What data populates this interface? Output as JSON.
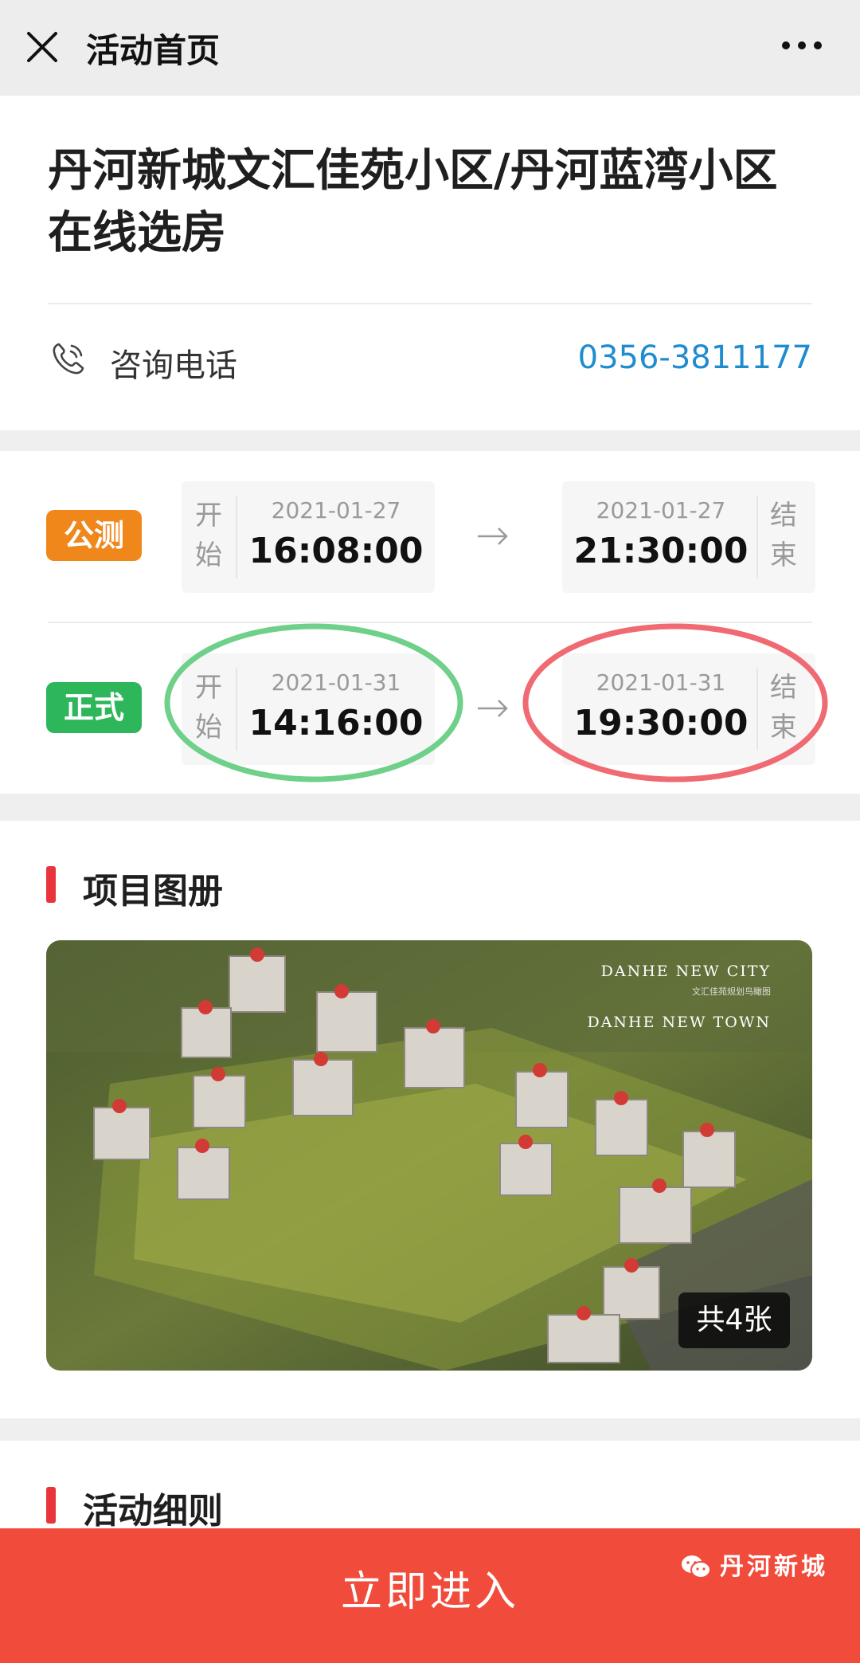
{
  "topbar": {
    "title": "活动首页"
  },
  "event": {
    "title": "丹河新城文汇佳苑小区/丹河蓝湾小区在线选房",
    "phone_label": "咨询电话",
    "phone_number": "0356-3811177"
  },
  "schedule": {
    "start_label_1": "开",
    "start_label_2": "始",
    "end_label_1": "结",
    "end_label_2": "束",
    "rows": [
      {
        "badge": "公测",
        "badge_color": "#f0871a",
        "start_date": "2021-01-27",
        "start_time": "16:08:00",
        "end_date": "2021-01-27",
        "end_time": "21:30:00"
      },
      {
        "badge": "正式",
        "badge_color": "#2db75a",
        "start_date": "2021-01-31",
        "start_time": "14:16:00",
        "end_date": "2021-01-31",
        "end_time": "19:30:00"
      }
    ],
    "annotation_colors": {
      "start": "#6fd08a",
      "end": "#ef6a72"
    }
  },
  "album": {
    "title": "项目图册",
    "count_label": "共4张",
    "brand_line_1": "DANHE NEW CITY",
    "brand_subline": "文汇佳苑规划鸟瞰图",
    "brand_line_2": "DANHE NEW TOWN"
  },
  "rules": {
    "title": "活动细则"
  },
  "cta": {
    "label": "立即进入"
  },
  "watermark": {
    "text": "丹河新城"
  },
  "colors": {
    "accent_red": "#e8353b",
    "cta_red": "#f14b3b",
    "link_blue": "#1f8ccf"
  }
}
